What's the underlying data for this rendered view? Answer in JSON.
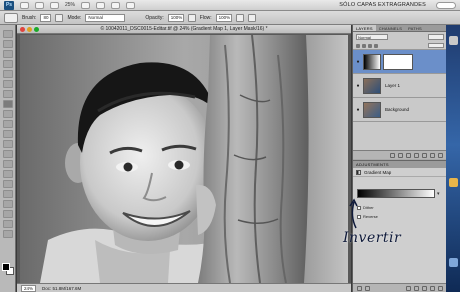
{
  "app": {
    "logo": "Ps",
    "zoom": "25%",
    "workspace": "SÓLO CAPAS EXTRAGRANDES"
  },
  "options": {
    "brush_label": "Brush:",
    "brush_size": "80",
    "mode_label": "Mode:",
    "mode_value": "Normal",
    "opacity_label": "Opacity:",
    "opacity_value": "100%",
    "flow_label": "Flow:",
    "flow_value": "100%"
  },
  "document": {
    "tab_title": "© 10042011_DSC0015-Editar.tif @ 24% (Gradient Map 1, Layer Mask/16) *",
    "zoom": "24%",
    "status": "Doc: 51.8M/167.6M"
  },
  "layers_panel": {
    "tabs": [
      "LAYERS",
      "CHANNELS",
      "PATHS"
    ],
    "blend_mode": "Normal",
    "layers": [
      {
        "name": "",
        "selected": true
      },
      {
        "name": "Layer 1",
        "selected": false
      },
      {
        "name": "Background",
        "selected": false
      }
    ]
  },
  "adjustments": {
    "header": "ADJUSTMENTS",
    "title": "Gradient Map",
    "dither_label": "Dither",
    "reverse_label": "Reverse"
  },
  "annotation": {
    "text": "Invertir"
  },
  "colors": {
    "selected_layer": "#6b8fc9",
    "desktop": "#2f5a98"
  }
}
